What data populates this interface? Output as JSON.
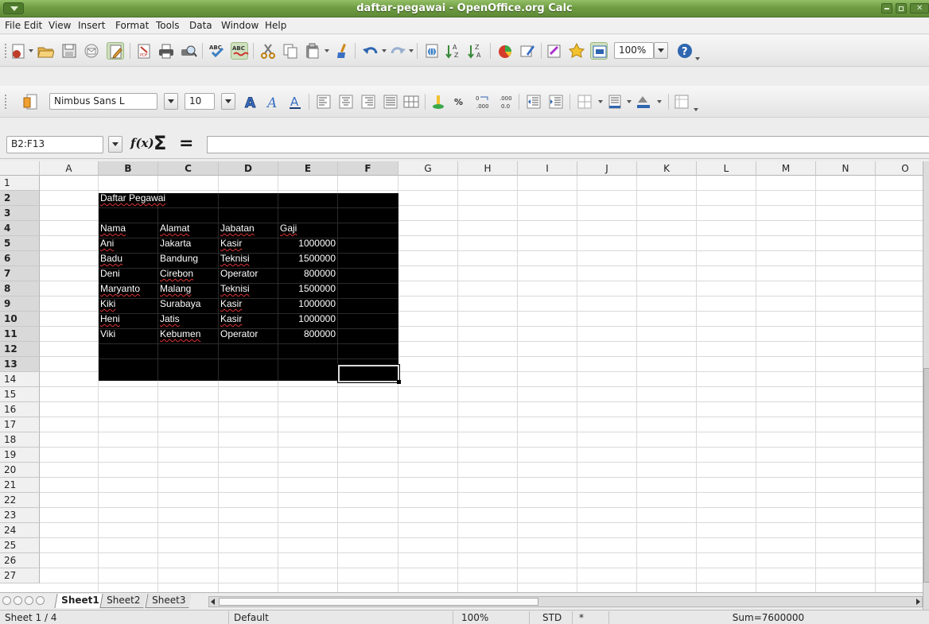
{
  "window": {
    "title": "daftar-pegawai - OpenOffice.org Calc"
  },
  "menu": [
    {
      "label": "File"
    },
    {
      "label": "Edit"
    },
    {
      "label": "View"
    },
    {
      "label": "Insert"
    },
    {
      "label": "Format"
    },
    {
      "label": "Tools"
    },
    {
      "label": "Data"
    },
    {
      "label": "Window"
    },
    {
      "label": "Help"
    }
  ],
  "toolbar": {
    "zoom_value": "100%",
    "standard_icons": [
      "new-document-icon",
      "open-folder-icon",
      "save-icon",
      "email-icon",
      "edit-file-icon",
      "export-pdf-icon",
      "print-icon",
      "page-preview-icon",
      "spellcheck-icon",
      "autospellcheck-icon",
      "cut-icon",
      "copy-icon",
      "paste-icon",
      "clone-format-icon",
      "undo-icon",
      "redo-icon",
      "hyperlink-icon",
      "sort-ascending-icon",
      "sort-descending-icon",
      "chart-icon",
      "draw-functions-icon",
      "navigator-icon",
      "gallery-icon",
      "datasource-icon",
      "zoom-icon",
      "help-icon"
    ]
  },
  "formatting": {
    "font_name": "Nimbus Sans L",
    "font_size": "10",
    "format_icons": [
      "styles-icon",
      "bold-icon",
      "italic-icon",
      "underline-icon",
      "align-left-icon",
      "align-center-icon",
      "align-right-icon",
      "justify-icon",
      "merge-cells-icon",
      "currency-icon",
      "percent-icon",
      "standard-format-icon",
      "add-decimal-icon",
      "delete-decimal-icon",
      "decrease-indent-icon",
      "increase-indent-icon",
      "borders-icon",
      "background-color-icon",
      "font-color-icon",
      "toggle-frame-icon"
    ]
  },
  "formula_bar": {
    "name_box": "B2:F13",
    "fx": "f(x)",
    "sigma": "Σ",
    "equals": "=",
    "content": ""
  },
  "columns": [
    "A",
    "B",
    "C",
    "D",
    "E",
    "F",
    "G",
    "H",
    "I",
    "J",
    "K",
    "L",
    "M",
    "N",
    "O"
  ],
  "rows": [
    "1",
    "2",
    "3",
    "4",
    "5",
    "6",
    "7",
    "8",
    "9",
    "10",
    "11",
    "12",
    "13",
    "14",
    "15",
    "16",
    "17",
    "18",
    "19",
    "20",
    "21",
    "22",
    "23",
    "24",
    "25",
    "26",
    "27"
  ],
  "sheet": {
    "title_cell": "Daftar Pegawai",
    "headers": [
      "Nama",
      "Alamat",
      "Jabatan",
      "Gaji"
    ],
    "records": [
      [
        "Ani",
        "Jakarta",
        "Kasir",
        "1000000"
      ],
      [
        "Badu",
        "Bandung",
        "Teknisi",
        "1500000"
      ],
      [
        "Deni",
        "Cirebon",
        "Operator",
        "800000"
      ],
      [
        "Maryanto",
        "Malang",
        "Teknisi",
        "1500000"
      ],
      [
        "Kiki",
        "Surabaya",
        "Kasir",
        "1000000"
      ],
      [
        "Heni",
        "Jatis",
        "Kasir",
        "1000000"
      ],
      [
        "Viki",
        "Kebumen",
        "Operator",
        "800000"
      ]
    ]
  },
  "tabs": [
    {
      "label": "Sheet1",
      "active": true
    },
    {
      "label": "Sheet2",
      "active": false
    },
    {
      "label": "Sheet3",
      "active": false
    }
  ],
  "status": {
    "sheet": "Sheet 1 / 4",
    "style": "Default",
    "zoom": "100%",
    "mode": "STD",
    "modified": "*",
    "sum": "Sum=7600000"
  }
}
